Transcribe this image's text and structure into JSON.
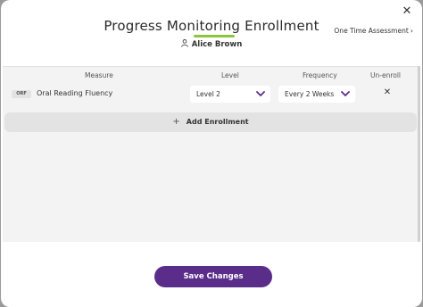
{
  "header": {
    "title": "Progress Monitoring Enrollment",
    "student_name": "Alice Brown",
    "one_time_link": "One Time Assessment",
    "accent_color": "#8cc63f"
  },
  "table": {
    "columns": [
      "Measure",
      "Level",
      "Frequency",
      "Un-enroll"
    ],
    "rows": [
      {
        "badge": "ORF",
        "measure": "Oral Reading Fluency",
        "level": "Level 2",
        "frequency": "Every 2 Weeks"
      }
    ]
  },
  "actions": {
    "add_enrollment": "Add Enrollment",
    "save": "Save Changes",
    "primary_color": "#5a2d8a"
  }
}
